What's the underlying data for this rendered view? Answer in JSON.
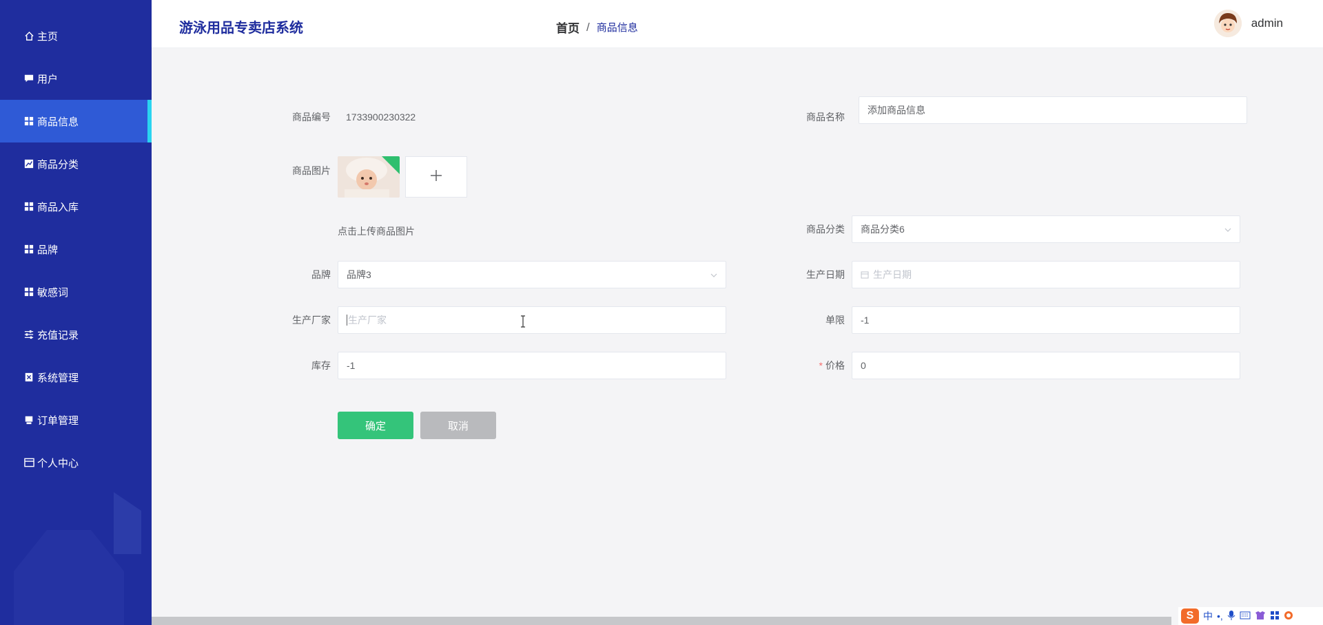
{
  "app": {
    "title": "游泳用品专卖店系统"
  },
  "breadcrumb": {
    "home": "首页",
    "separator": "/",
    "current": "商品信息"
  },
  "user": {
    "name": "admin"
  },
  "sidebar": {
    "items": [
      {
        "label": "主页",
        "icon": "home-icon"
      },
      {
        "label": "用户",
        "icon": "chat-icon"
      },
      {
        "label": "商品信息",
        "icon": "grid-icon",
        "active": true
      },
      {
        "label": "商品分类",
        "icon": "chart-icon"
      },
      {
        "label": "商品入库",
        "icon": "grid-icon"
      },
      {
        "label": "品牌",
        "icon": "grid-icon"
      },
      {
        "label": "敏感词",
        "icon": "grid-icon"
      },
      {
        "label": "充值记录",
        "icon": "sliders-icon"
      },
      {
        "label": "系统管理",
        "icon": "clipboard-icon"
      },
      {
        "label": "订单管理",
        "icon": "printer-icon"
      },
      {
        "label": "个人中心",
        "icon": "card-icon"
      }
    ]
  },
  "form": {
    "code_label": "商品编号",
    "code_value": "1733900230322",
    "name_label": "商品名称",
    "name_value": "添加商品信息",
    "image_label": "商品图片",
    "upload_tip": "点击上传商品图片",
    "category_label": "商品分类",
    "category_value": "商品分类6",
    "brand_label": "品牌",
    "brand_value": "品牌3",
    "date_label": "生产日期",
    "date_placeholder": "生产日期",
    "maker_label": "生产厂家",
    "maker_placeholder": "生产厂家",
    "limit_label": "单限",
    "limit_value": "-1",
    "stock_label": "库存",
    "stock_value": "-1",
    "price_label": "价格",
    "price_required": "*",
    "price_value": "0",
    "ok_label": "确定",
    "cancel_label": "取消"
  },
  "tray": {
    "ime_logo": "S",
    "ime_lang": "中",
    "punct": "•,"
  },
  "colors": {
    "sidebar": "#1f2d9e",
    "active": "#2f5ad6",
    "accent": "#2ad4f0",
    "ok": "#34c47a",
    "cancel": "#b9babd"
  }
}
